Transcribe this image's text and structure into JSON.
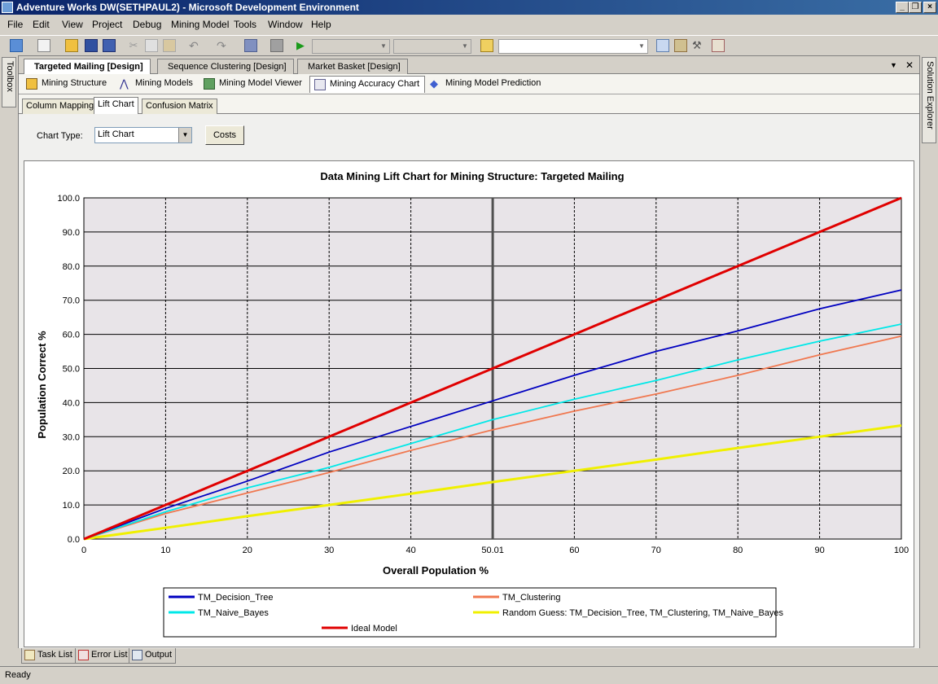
{
  "window": {
    "title": "Adventure Works DW(SETHPAUL2) - Microsoft Development Environment",
    "minimize_icon": "minimize-icon",
    "maximize_icon": "restore-icon",
    "close_icon": "close-icon"
  },
  "menu": [
    "File",
    "Edit",
    "View",
    "Project",
    "Debug",
    "Mining Model",
    "Tools",
    "Window",
    "Help"
  ],
  "left_strip": {
    "toolbox_label": "Toolbox"
  },
  "right_strip": {
    "solution_explorer_label": "Solution Explorer"
  },
  "document_tabs": [
    {
      "label": "Targeted Mailing [Design]",
      "active": true
    },
    {
      "label": "Sequence Clustering [Design]",
      "active": false
    },
    {
      "label": "Market Basket [Design]",
      "active": false
    }
  ],
  "designer_tabs": [
    {
      "label": "Mining Structure",
      "icon": "mining-structure-icon"
    },
    {
      "label": "Mining Models",
      "icon": "mining-models-icon"
    },
    {
      "label": "Mining Model Viewer",
      "icon": "mining-model-viewer-icon"
    },
    {
      "label": "Mining Accuracy Chart",
      "icon": "accuracy-chart-icon",
      "active": true
    },
    {
      "label": "Mining Model Prediction",
      "icon": "diamond-icon"
    }
  ],
  "sub_tabs": [
    {
      "label": "Column Mapping"
    },
    {
      "label": "Lift Chart",
      "active": true
    },
    {
      "label": "Confusion Matrix"
    }
  ],
  "chart_controls": {
    "chart_type_label": "Chart Type:",
    "chart_type_value": "Lift Chart",
    "costs_label": "Costs"
  },
  "chart_data": {
    "type": "line",
    "title": "Data Mining Lift Chart for Mining Structure: Targeted Mailing",
    "xlabel": "Overall Population %",
    "ylabel": "Population Correct %",
    "xlim": [
      0,
      100
    ],
    "ylim": [
      0,
      100
    ],
    "x_ticks": [
      "0",
      "10",
      "20",
      "30",
      "40",
      "50.01",
      "60",
      "70",
      "80",
      "90",
      "100"
    ],
    "y_ticks": [
      "0.0",
      "10.0",
      "20.0",
      "30.0",
      "40.0",
      "50.0",
      "60.0",
      "70.0",
      "80.0",
      "90.0",
      "100.0"
    ],
    "grid": true,
    "marker_x": 50.01,
    "legend_position": "bottom",
    "series": [
      {
        "name": "TM_Decision_Tree",
        "color": "#0000c0",
        "x": [
          0,
          10,
          20,
          30,
          40,
          50,
          60,
          70,
          80,
          90,
          100
        ],
        "values": [
          0,
          9,
          17,
          25.5,
          33,
          40.5,
          48,
          55,
          61,
          67.5,
          73
        ]
      },
      {
        "name": "TM_Clustering",
        "color": "#f07850",
        "x": [
          0,
          10,
          20,
          30,
          40,
          50,
          60,
          70,
          80,
          90,
          100
        ],
        "values": [
          0,
          7.5,
          13.5,
          19.5,
          26,
          32,
          37.5,
          42.5,
          48,
          54,
          59.5
        ]
      },
      {
        "name": "TM_Naive_Bayes",
        "color": "#00e8e8",
        "x": [
          0,
          10,
          20,
          30,
          40,
          50,
          60,
          70,
          80,
          90,
          100
        ],
        "values": [
          0,
          8,
          15,
          21,
          28,
          35,
          41,
          46.5,
          52.5,
          58,
          63
        ]
      },
      {
        "name": "Random Guess: TM_Decision_Tree, TM_Clustering, TM_Naive_Bayes",
        "color": "#f0f000",
        "x": [
          0,
          10,
          20,
          30,
          40,
          50,
          60,
          70,
          80,
          90,
          100
        ],
        "values": [
          0,
          3.3,
          6.7,
          10,
          13.3,
          16.7,
          20,
          23.3,
          26.7,
          30,
          33.3
        ]
      },
      {
        "name": "Ideal Model",
        "color": "#e00000",
        "x": [
          0,
          10,
          20,
          30,
          40,
          50,
          60,
          70,
          80,
          90,
          100
        ],
        "values": [
          0,
          10,
          20,
          30,
          40,
          50,
          60,
          70,
          80,
          90,
          100
        ]
      }
    ]
  },
  "bottom_tabs": [
    {
      "label": "Task List",
      "icon": "task-list-icon"
    },
    {
      "label": "Error List",
      "icon": "error-list-icon"
    },
    {
      "label": "Output",
      "icon": "output-icon"
    }
  ],
  "status": {
    "text": "Ready"
  }
}
